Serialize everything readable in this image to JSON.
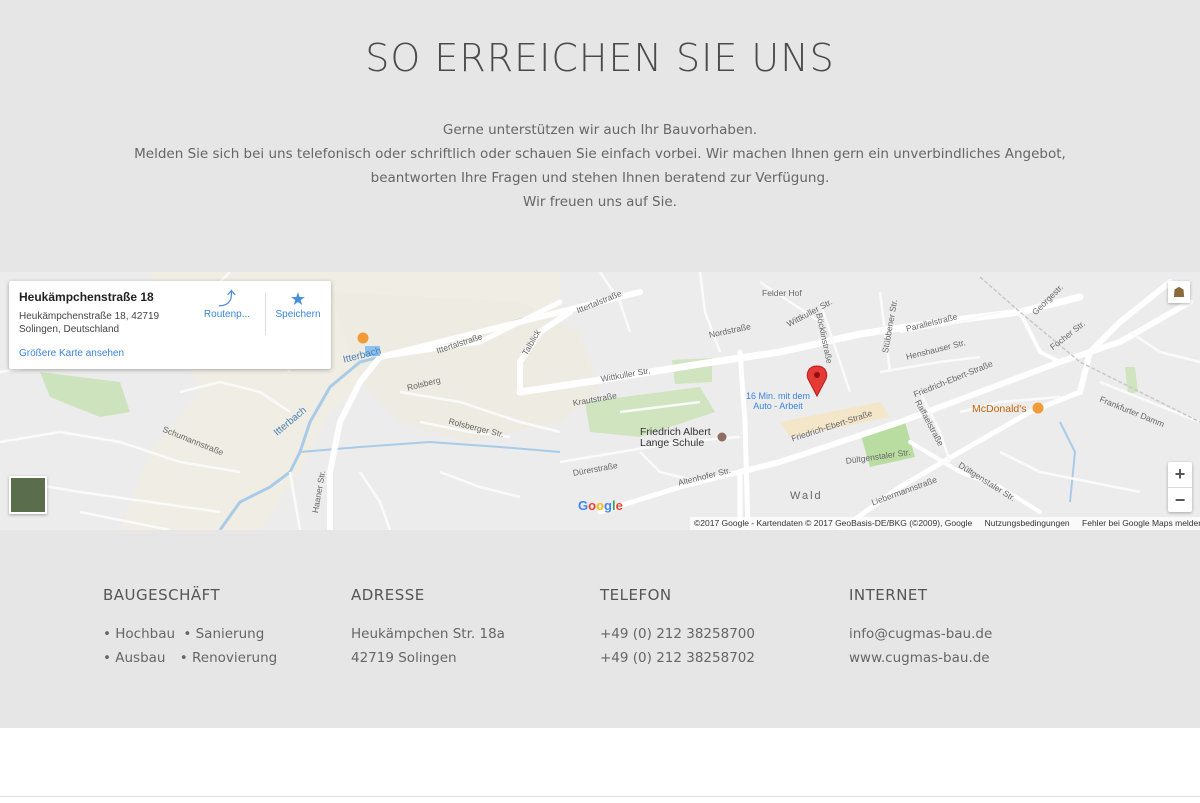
{
  "heading": "SO ERREICHEN SIE UNS",
  "intro": [
    "Gerne unterstützen wir auch Ihr Bauvorhaben.",
    "Melden Sie sich bei uns telefonisch oder schriftlich oder schauen Sie einfach vorbei. Wir machen Ihnen gern ein unverbindliches Angebot,",
    "beantworten Ihre Fragen und stehen Ihnen beratend zur Verfügung.",
    "Wir freuen uns auf Sie."
  ],
  "map": {
    "card": {
      "address_title": "Heukämpchenstraße 18",
      "address_line1": "Heukämpchenstraße 18, 42719",
      "address_line2": "Solingen, Deutschland",
      "larger_map_link": "Größere Karte ansehen",
      "route_label": "Routenp...",
      "save_label": "Speichern",
      "route_icon": "directions-icon",
      "save_icon": "star-icon"
    },
    "pin_label": "16 Min. mit dem Auto - Arbeit",
    "places": {
      "school": "Friedrich Albert Lange Schule",
      "mcdonalds": "McDonald's",
      "wald": "Wald"
    },
    "streets": {
      "ittertalstrasse_1": "Ittertalstraße",
      "ittertalstrasse_2": "Ittertalstraße",
      "wittkuller": "Wittkuller Str.",
      "wittkuller_2": "Wittkuller Str.",
      "friedrich_ebert": "Friedrich-Ebert-Straße",
      "friedrich_ebert_2": "Friedrich-Ebert-Straße",
      "henshauser": "Henshauser Str.",
      "parallel": "Parallelstraße",
      "duelt": "Dültgenstaler Str.",
      "duelt_2": "Dültgenstaler Str.",
      "altenhofer": "Altenhofer Str.",
      "duerer": "Dürerstraße",
      "krautstrasse": "Krautstraße",
      "rolsberg": "Rolsberg",
      "rolsberger": "Rolsberger Str.",
      "schumann": "Schumannstraße",
      "itterbach": "Itterbach",
      "itterbach_2": "Itterbach",
      "haaner": "Haaner Str.",
      "frankfurter": "Frankfurter Damm",
      "focher": "Focher Str.",
      "liebermann": "Liebermannstraße",
      "raffael": "Raffaelstraße",
      "boecklin": "Böcklinstraße",
      "nord": "Nordstraße",
      "felder": "Felder Hof",
      "talblick": "Talblick",
      "stuebbener": "Stübbener Str.",
      "georgestr": "Georgestr."
    },
    "google_logo": "Google",
    "attribution": "©2017 Google - Kartendaten © 2017 GeoBasis-DE/BKG (©2009), Google",
    "terms": "Nutzungsbedingungen",
    "report": "Fehler bei Google Maps melden",
    "zoom_in": "+",
    "zoom_out": "−"
  },
  "footer": {
    "business": {
      "title": "BAUGESCHÄFT",
      "items_row1": [
        "• Hochbau",
        "• Sanierung"
      ],
      "items_row2": [
        "• Ausbau",
        "• Renovierung"
      ]
    },
    "address": {
      "title": "ADRESSE",
      "line1": "Heukämpchen Str. 18a",
      "line2": "42719 Solingen"
    },
    "phone": {
      "title": "TELEFON",
      "line1": "+49 (0) 212 38258700",
      "line2": "+49 (0) 212 38258702"
    },
    "internet": {
      "title": "INTERNET",
      "email": "info@cugmas-bau.de",
      "web": "www.cugmas-bau.de"
    }
  },
  "colors": {
    "section_bg": "#e6e6e6",
    "link_blue": "#3a84df",
    "pin_red": "#e53935"
  }
}
